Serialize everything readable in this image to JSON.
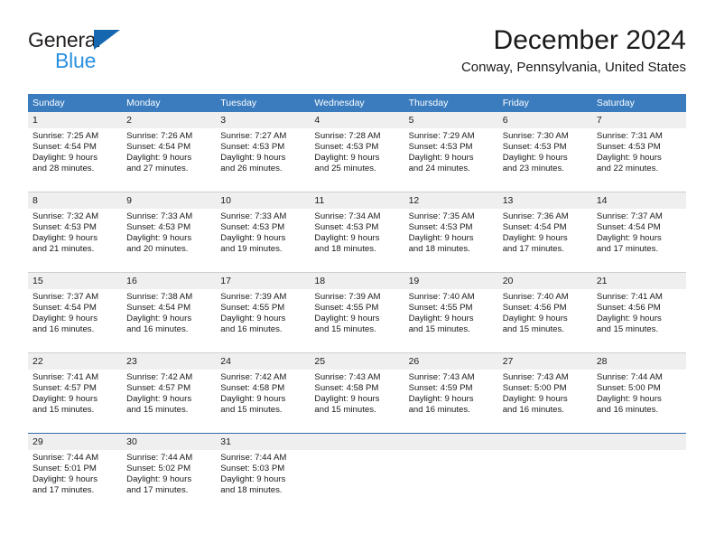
{
  "brand": {
    "name_part1": "General",
    "name_part2": "Blue"
  },
  "header": {
    "title": "December 2024",
    "subtitle": "Conway, Pennsylvania, United States"
  },
  "colors": {
    "header_blue": "#3a7cbe",
    "daynum_band": "#efefef",
    "rule_gray": "#cfcfcf",
    "rule_blue": "#2f6fae",
    "logo_dark": "#231f20",
    "logo_blue": "#2a91e0",
    "logo_triangle": "#1568b0"
  },
  "weekdays": [
    "Sunday",
    "Monday",
    "Tuesday",
    "Wednesday",
    "Thursday",
    "Friday",
    "Saturday"
  ],
  "weeks": [
    {
      "days": [
        {
          "num": "1",
          "sunrise": "Sunrise: 7:25 AM",
          "sunset": "Sunset: 4:54 PM",
          "daylight1": "Daylight: 9 hours",
          "daylight2": "and 28 minutes."
        },
        {
          "num": "2",
          "sunrise": "Sunrise: 7:26 AM",
          "sunset": "Sunset: 4:54 PM",
          "daylight1": "Daylight: 9 hours",
          "daylight2": "and 27 minutes."
        },
        {
          "num": "3",
          "sunrise": "Sunrise: 7:27 AM",
          "sunset": "Sunset: 4:53 PM",
          "daylight1": "Daylight: 9 hours",
          "daylight2": "and 26 minutes."
        },
        {
          "num": "4",
          "sunrise": "Sunrise: 7:28 AM",
          "sunset": "Sunset: 4:53 PM",
          "daylight1": "Daylight: 9 hours",
          "daylight2": "and 25 minutes."
        },
        {
          "num": "5",
          "sunrise": "Sunrise: 7:29 AM",
          "sunset": "Sunset: 4:53 PM",
          "daylight1": "Daylight: 9 hours",
          "daylight2": "and 24 minutes."
        },
        {
          "num": "6",
          "sunrise": "Sunrise: 7:30 AM",
          "sunset": "Sunset: 4:53 PM",
          "daylight1": "Daylight: 9 hours",
          "daylight2": "and 23 minutes."
        },
        {
          "num": "7",
          "sunrise": "Sunrise: 7:31 AM",
          "sunset": "Sunset: 4:53 PM",
          "daylight1": "Daylight: 9 hours",
          "daylight2": "and 22 minutes."
        }
      ]
    },
    {
      "days": [
        {
          "num": "8",
          "sunrise": "Sunrise: 7:32 AM",
          "sunset": "Sunset: 4:53 PM",
          "daylight1": "Daylight: 9 hours",
          "daylight2": "and 21 minutes."
        },
        {
          "num": "9",
          "sunrise": "Sunrise: 7:33 AM",
          "sunset": "Sunset: 4:53 PM",
          "daylight1": "Daylight: 9 hours",
          "daylight2": "and 20 minutes."
        },
        {
          "num": "10",
          "sunrise": "Sunrise: 7:33 AM",
          "sunset": "Sunset: 4:53 PM",
          "daylight1": "Daylight: 9 hours",
          "daylight2": "and 19 minutes."
        },
        {
          "num": "11",
          "sunrise": "Sunrise: 7:34 AM",
          "sunset": "Sunset: 4:53 PM",
          "daylight1": "Daylight: 9 hours",
          "daylight2": "and 18 minutes."
        },
        {
          "num": "12",
          "sunrise": "Sunrise: 7:35 AM",
          "sunset": "Sunset: 4:53 PM",
          "daylight1": "Daylight: 9 hours",
          "daylight2": "and 18 minutes."
        },
        {
          "num": "13",
          "sunrise": "Sunrise: 7:36 AM",
          "sunset": "Sunset: 4:54 PM",
          "daylight1": "Daylight: 9 hours",
          "daylight2": "and 17 minutes."
        },
        {
          "num": "14",
          "sunrise": "Sunrise: 7:37 AM",
          "sunset": "Sunset: 4:54 PM",
          "daylight1": "Daylight: 9 hours",
          "daylight2": "and 17 minutes."
        }
      ]
    },
    {
      "days": [
        {
          "num": "15",
          "sunrise": "Sunrise: 7:37 AM",
          "sunset": "Sunset: 4:54 PM",
          "daylight1": "Daylight: 9 hours",
          "daylight2": "and 16 minutes."
        },
        {
          "num": "16",
          "sunrise": "Sunrise: 7:38 AM",
          "sunset": "Sunset: 4:54 PM",
          "daylight1": "Daylight: 9 hours",
          "daylight2": "and 16 minutes."
        },
        {
          "num": "17",
          "sunrise": "Sunrise: 7:39 AM",
          "sunset": "Sunset: 4:55 PM",
          "daylight1": "Daylight: 9 hours",
          "daylight2": "and 16 minutes."
        },
        {
          "num": "18",
          "sunrise": "Sunrise: 7:39 AM",
          "sunset": "Sunset: 4:55 PM",
          "daylight1": "Daylight: 9 hours",
          "daylight2": "and 15 minutes."
        },
        {
          "num": "19",
          "sunrise": "Sunrise: 7:40 AM",
          "sunset": "Sunset: 4:55 PM",
          "daylight1": "Daylight: 9 hours",
          "daylight2": "and 15 minutes."
        },
        {
          "num": "20",
          "sunrise": "Sunrise: 7:40 AM",
          "sunset": "Sunset: 4:56 PM",
          "daylight1": "Daylight: 9 hours",
          "daylight2": "and 15 minutes."
        },
        {
          "num": "21",
          "sunrise": "Sunrise: 7:41 AM",
          "sunset": "Sunset: 4:56 PM",
          "daylight1": "Daylight: 9 hours",
          "daylight2": "and 15 minutes."
        }
      ]
    },
    {
      "days": [
        {
          "num": "22",
          "sunrise": "Sunrise: 7:41 AM",
          "sunset": "Sunset: 4:57 PM",
          "daylight1": "Daylight: 9 hours",
          "daylight2": "and 15 minutes."
        },
        {
          "num": "23",
          "sunrise": "Sunrise: 7:42 AM",
          "sunset": "Sunset: 4:57 PM",
          "daylight1": "Daylight: 9 hours",
          "daylight2": "and 15 minutes."
        },
        {
          "num": "24",
          "sunrise": "Sunrise: 7:42 AM",
          "sunset": "Sunset: 4:58 PM",
          "daylight1": "Daylight: 9 hours",
          "daylight2": "and 15 minutes."
        },
        {
          "num": "25",
          "sunrise": "Sunrise: 7:43 AM",
          "sunset": "Sunset: 4:58 PM",
          "daylight1": "Daylight: 9 hours",
          "daylight2": "and 15 minutes."
        },
        {
          "num": "26",
          "sunrise": "Sunrise: 7:43 AM",
          "sunset": "Sunset: 4:59 PM",
          "daylight1": "Daylight: 9 hours",
          "daylight2": "and 16 minutes."
        },
        {
          "num": "27",
          "sunrise": "Sunrise: 7:43 AM",
          "sunset": "Sunset: 5:00 PM",
          "daylight1": "Daylight: 9 hours",
          "daylight2": "and 16 minutes."
        },
        {
          "num": "28",
          "sunrise": "Sunrise: 7:44 AM",
          "sunset": "Sunset: 5:00 PM",
          "daylight1": "Daylight: 9 hours",
          "daylight2": "and 16 minutes."
        }
      ]
    },
    {
      "days": [
        {
          "num": "29",
          "sunrise": "Sunrise: 7:44 AM",
          "sunset": "Sunset: 5:01 PM",
          "daylight1": "Daylight: 9 hours",
          "daylight2": "and 17 minutes."
        },
        {
          "num": "30",
          "sunrise": "Sunrise: 7:44 AM",
          "sunset": "Sunset: 5:02 PM",
          "daylight1": "Daylight: 9 hours",
          "daylight2": "and 17 minutes."
        },
        {
          "num": "31",
          "sunrise": "Sunrise: 7:44 AM",
          "sunset": "Sunset: 5:03 PM",
          "daylight1": "Daylight: 9 hours",
          "daylight2": "and 18 minutes."
        },
        {
          "num": "",
          "sunrise": "",
          "sunset": "",
          "daylight1": "",
          "daylight2": ""
        },
        {
          "num": "",
          "sunrise": "",
          "sunset": "",
          "daylight1": "",
          "daylight2": ""
        },
        {
          "num": "",
          "sunrise": "",
          "sunset": "",
          "daylight1": "",
          "daylight2": ""
        },
        {
          "num": "",
          "sunrise": "",
          "sunset": "",
          "daylight1": "",
          "daylight2": ""
        }
      ]
    }
  ]
}
